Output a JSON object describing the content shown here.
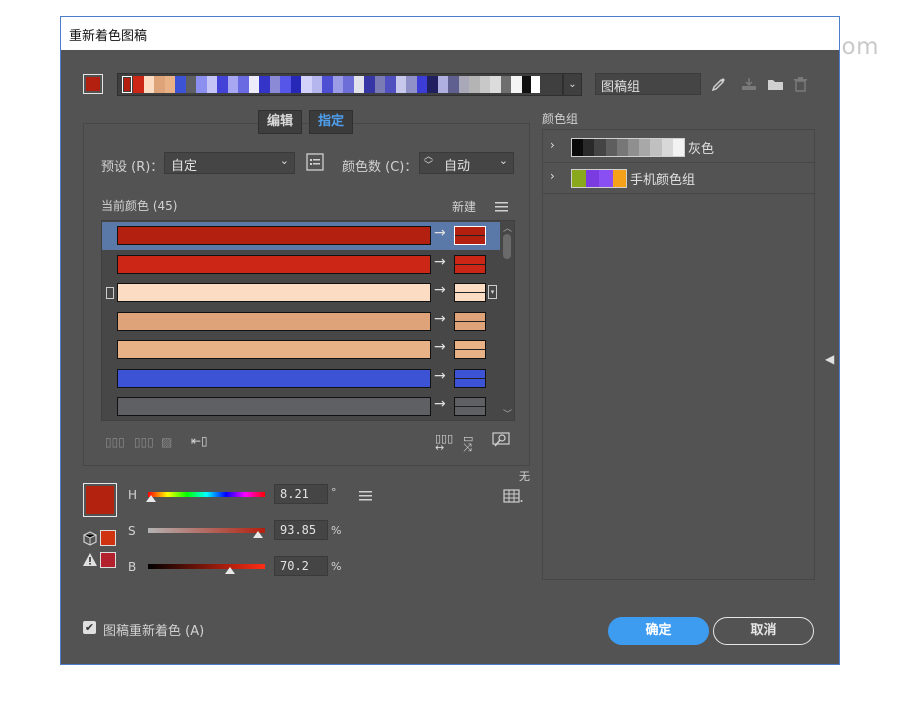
{
  "watermark": "电脑网 Yuucn.com",
  "dialog": {
    "title": "重新着色图稿",
    "group_name": "图稿组",
    "tabs": [
      {
        "label": "编辑",
        "active": false
      },
      {
        "label": "指定",
        "active": true
      }
    ],
    "preset": {
      "label": "预设 (R)：",
      "value": "自定"
    },
    "color_count": {
      "label": "颜色数 (C)：",
      "value": "自动"
    },
    "current_colors_label": "当前颜色 (45)",
    "new_label": "新建",
    "none_label": "无",
    "rows": [
      {
        "current": "#b3200f",
        "new": "#b3200f",
        "selected": true
      },
      {
        "current": "#cc2616",
        "new": "#cc2616",
        "selected": false
      },
      {
        "current": "#fddcc4",
        "new": "#fddcc4",
        "selected": false
      },
      {
        "current": "#dfa37a",
        "new": "#dfa37a",
        "selected": false
      },
      {
        "current": "#e8b286",
        "new": "#e8b286",
        "selected": false
      },
      {
        "current": "#3c53d6",
        "new": "#3c53d6",
        "selected": false
      },
      {
        "current": "#5f6064",
        "new": "#5f6064",
        "selected": false
      }
    ],
    "hsb": {
      "h": {
        "label": "H",
        "value": "8.21",
        "unit": "°",
        "position": 0.023
      },
      "s": {
        "label": "S",
        "value": "93.85",
        "unit": "%",
        "position": 0.9385
      },
      "b": {
        "label": "B",
        "value": "70.2",
        "unit": "%",
        "position": 0.702
      }
    },
    "color_groups_label": "颜色组",
    "groups": [
      {
        "name": "灰色",
        "colors": [
          "#0a0a0a",
          "#2a2a2a",
          "#444444",
          "#5e5e5e",
          "#777777",
          "#8f8f8f",
          "#a8a8a8",
          "#c0c0c0",
          "#d8d8d8",
          "#f2f2f2"
        ]
      },
      {
        "name": "手机颜色组",
        "colors": [
          "#8aa81c",
          "#7a3ce0",
          "#8a4ff2",
          "#f5a21a"
        ]
      }
    ],
    "recolor_checkbox": {
      "label": "图稿重新着色 (A)",
      "checked": true
    },
    "ok_label": "确定",
    "cancel_label": "取消",
    "strip_colors": [
      "#b3200f",
      "#cc2616",
      "#fddcc4",
      "#dfa37a",
      "#e8b286",
      "#3c53d6",
      "#5f6064",
      "#8b8ff0",
      "#c4c4f6",
      "#4343d8",
      "#a8a8f2",
      "#6a6ae2",
      "#ececfd",
      "#3434c9",
      "#8a8ad6",
      "#5656e8",
      "#2828b8",
      "#d2d2fa",
      "#b6b6ee",
      "#4f4fd4",
      "#9c9ce6",
      "#6e6ed8",
      "#e2e2ea",
      "#3636a4",
      "#7a7ab4",
      "#5050c0",
      "#c8c8ec",
      "#9090c8",
      "#3c3cd6",
      "#202060",
      "#b0b0e0",
      "#606090",
      "#a8a8b8",
      "#b4b4b4",
      "#c8c8c8",
      "#dcdcdc",
      "#6e6e6e",
      "#f4f4f4",
      "#101010",
      "#ffffff"
    ]
  }
}
